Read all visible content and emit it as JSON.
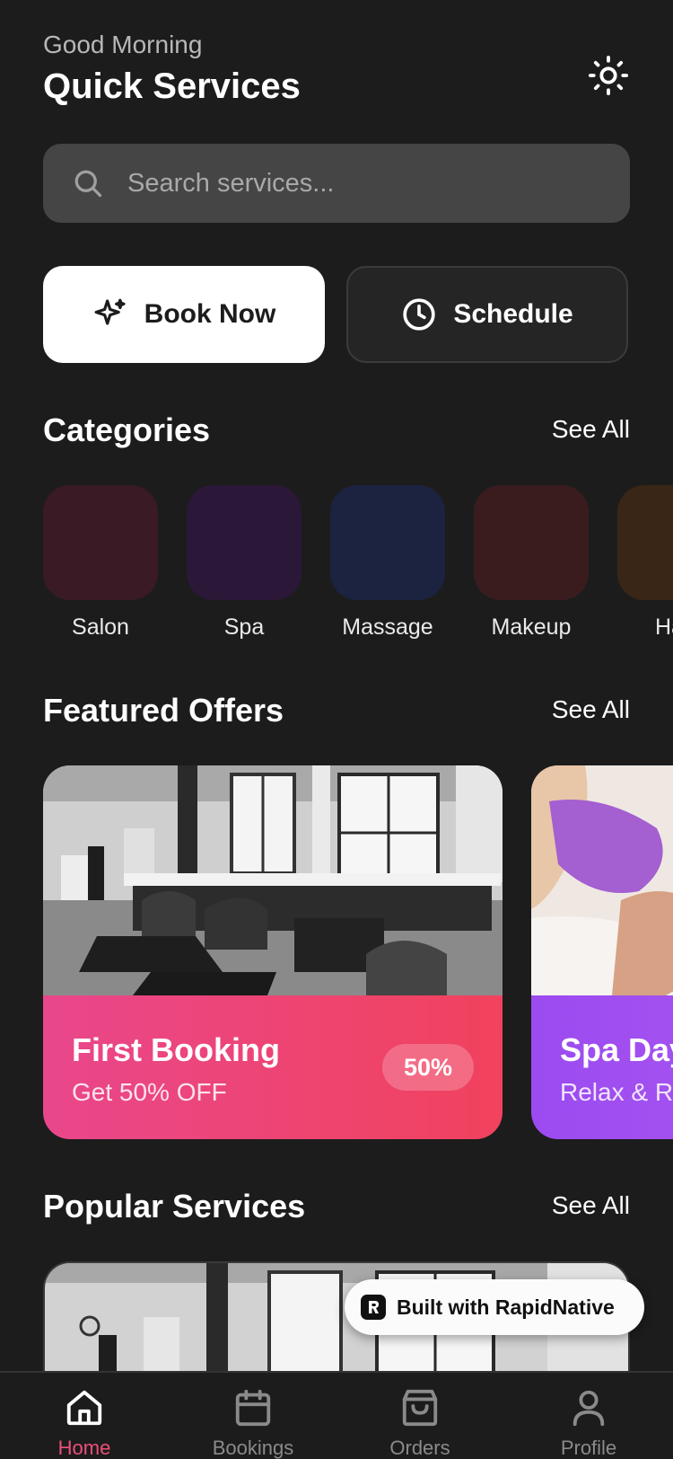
{
  "header": {
    "greeting": "Good Morning",
    "title": "Quick Services",
    "theme_icon": "sun-icon"
  },
  "search": {
    "placeholder": "Search services..."
  },
  "actions": {
    "book_label": "Book Now",
    "schedule_label": "Schedule"
  },
  "categories": {
    "title": "Categories",
    "see_all": "See All",
    "items": [
      {
        "label": "Salon",
        "color": "#3a1a24"
      },
      {
        "label": "Spa",
        "color": "#2b1838"
      },
      {
        "label": "Massage",
        "color": "#1c2340"
      },
      {
        "label": "Makeup",
        "color": "#3a1c1f"
      },
      {
        "label": "Ha",
        "color": "#3a2616"
      }
    ]
  },
  "offers": {
    "title": "Featured Offers",
    "see_all": "See All",
    "items": [
      {
        "title": "First Booking",
        "subtitle": "Get 50% OFF",
        "badge": "50%",
        "gradient_from": "#e9478c",
        "gradient_to": "#f1425d"
      },
      {
        "title": "Spa Day",
        "subtitle": "Relax & Re",
        "badge": "",
        "gradient_from": "#9b4bf0",
        "gradient_to": "#b45cf2"
      }
    ]
  },
  "popular": {
    "title": "Popular Services",
    "see_all": "See All"
  },
  "badge": {
    "label": "Built with RapidNative"
  },
  "tabs": [
    {
      "label": "Home",
      "icon": "home-icon",
      "active": true
    },
    {
      "label": "Bookings",
      "icon": "calendar-icon",
      "active": false
    },
    {
      "label": "Orders",
      "icon": "shopping-bag-icon",
      "active": false
    },
    {
      "label": "Profile",
      "icon": "user-icon",
      "active": false
    }
  ],
  "colors": {
    "background": "#1c1c1c",
    "accent": "#ec4f7a"
  }
}
